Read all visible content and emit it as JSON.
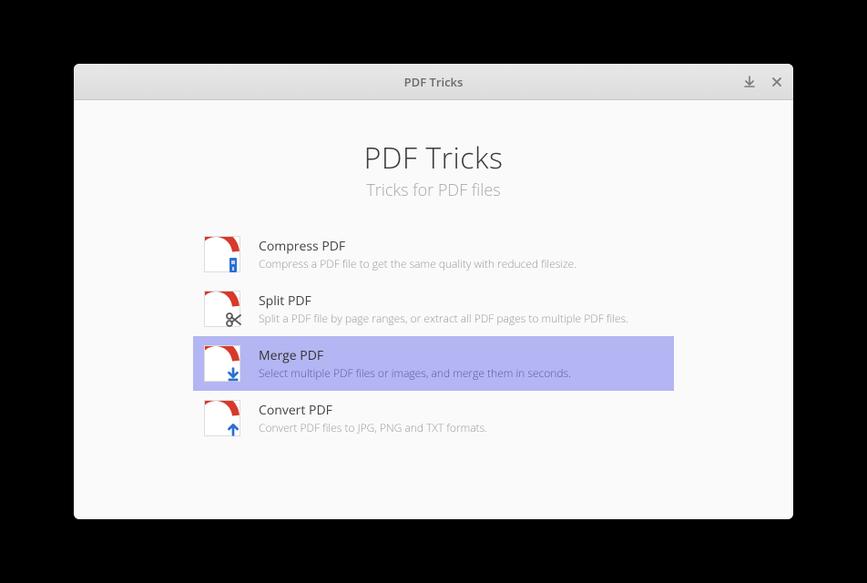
{
  "titlebar": {
    "title": "PDF Tricks"
  },
  "header": {
    "title": "PDF Tricks",
    "subtitle": "Tricks for PDF files"
  },
  "items": [
    {
      "title": "Compress PDF",
      "desc": "Compress a PDF file to get the same quality with reduced filesize.",
      "selected": false
    },
    {
      "title": "Split PDF",
      "desc": "Split a PDF file by page ranges, or extract all PDF pages to multiple PDF files.",
      "selected": false
    },
    {
      "title": "Merge PDF",
      "desc": "Select multiple PDF files or images, and merge them in seconds.",
      "selected": true
    },
    {
      "title": "Convert PDF",
      "desc": "Convert PDF files to JPG, PNG and TXT formats.",
      "selected": false
    }
  ]
}
